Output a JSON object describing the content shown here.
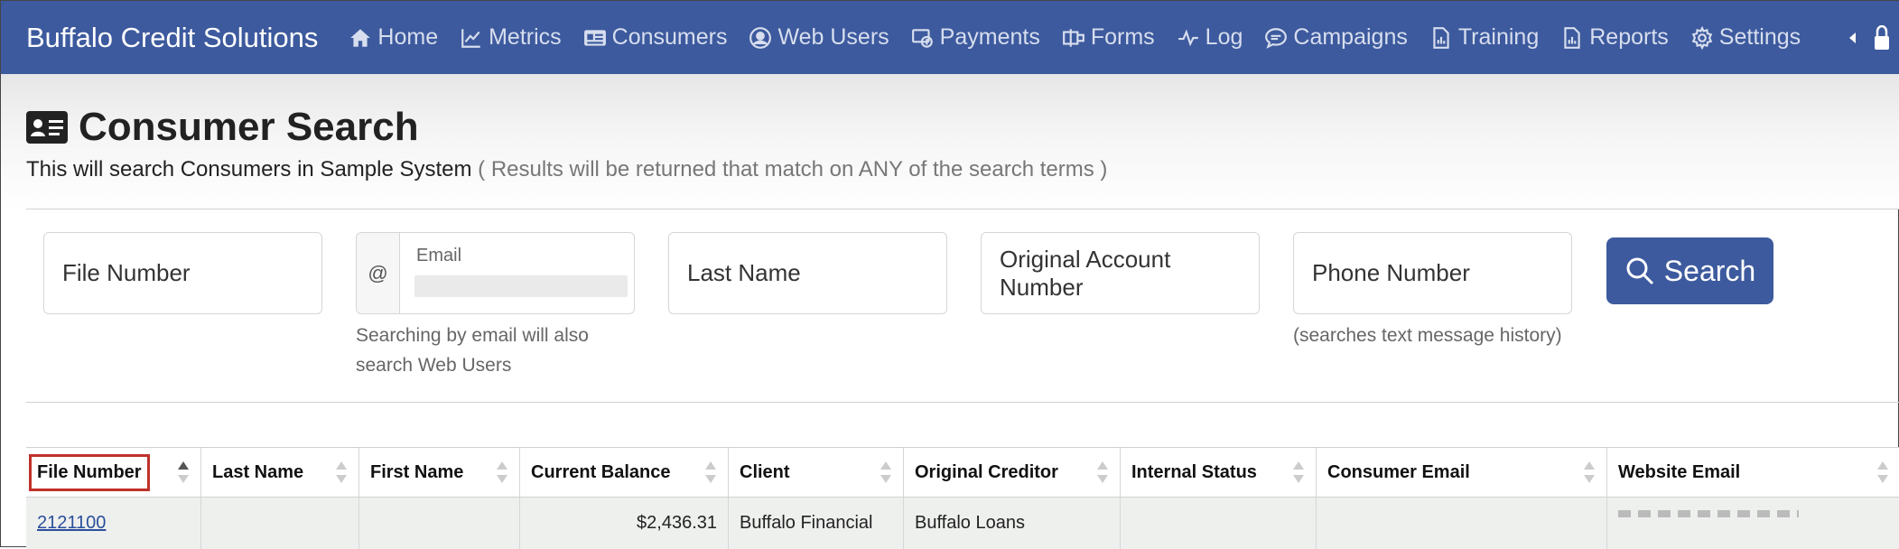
{
  "navbar": {
    "brand": "Buffalo Credit Solutions",
    "items": [
      {
        "label": "Home",
        "icon": "home-icon"
      },
      {
        "label": "Metrics",
        "icon": "line-chart-icon"
      },
      {
        "label": "Consumers",
        "icon": "id-card-icon"
      },
      {
        "label": "Web Users",
        "icon": "user-circle-icon"
      },
      {
        "label": "Payments",
        "icon": "payment-icon"
      },
      {
        "label": "Forms",
        "icon": "forms-icon"
      },
      {
        "label": "Log",
        "icon": "pulse-icon"
      },
      {
        "label": "Campaigns",
        "icon": "chat-icon"
      },
      {
        "label": "Training",
        "icon": "report-file-icon"
      },
      {
        "label": "Reports",
        "icon": "report-file-icon"
      },
      {
        "label": "Settings",
        "icon": "gear-icon"
      }
    ]
  },
  "page": {
    "title": "Consumer Search",
    "subtitle": "This will search Consumers in Sample System",
    "subtitle_note": "( Results will be returned that match on ANY of the search terms )"
  },
  "search": {
    "file_number_placeholder": "File Number",
    "email_addon": "@",
    "email_label": "Email",
    "email_help_line1": "Searching by email will also",
    "email_help_line2": "search Web Users",
    "last_name_placeholder": "Last Name",
    "original_account_placeholder": "Original Account Number",
    "phone_placeholder": "Phone Number",
    "phone_help": "(searches text message history)",
    "button_label": "Search"
  },
  "table": {
    "columns": [
      "File Number",
      "Last Name",
      "First Name",
      "Current Balance",
      "Client",
      "Original Creditor",
      "Internal Status",
      "Consumer Email",
      "Website Email"
    ],
    "rows": [
      {
        "file_number": "2121100",
        "last_name": "",
        "first_name": "",
        "current_balance": "$2,436.31",
        "client": "Buffalo Financial",
        "original_creditor": "Buffalo Loans",
        "internal_status": "",
        "consumer_email": "",
        "website_email": ""
      }
    ]
  }
}
